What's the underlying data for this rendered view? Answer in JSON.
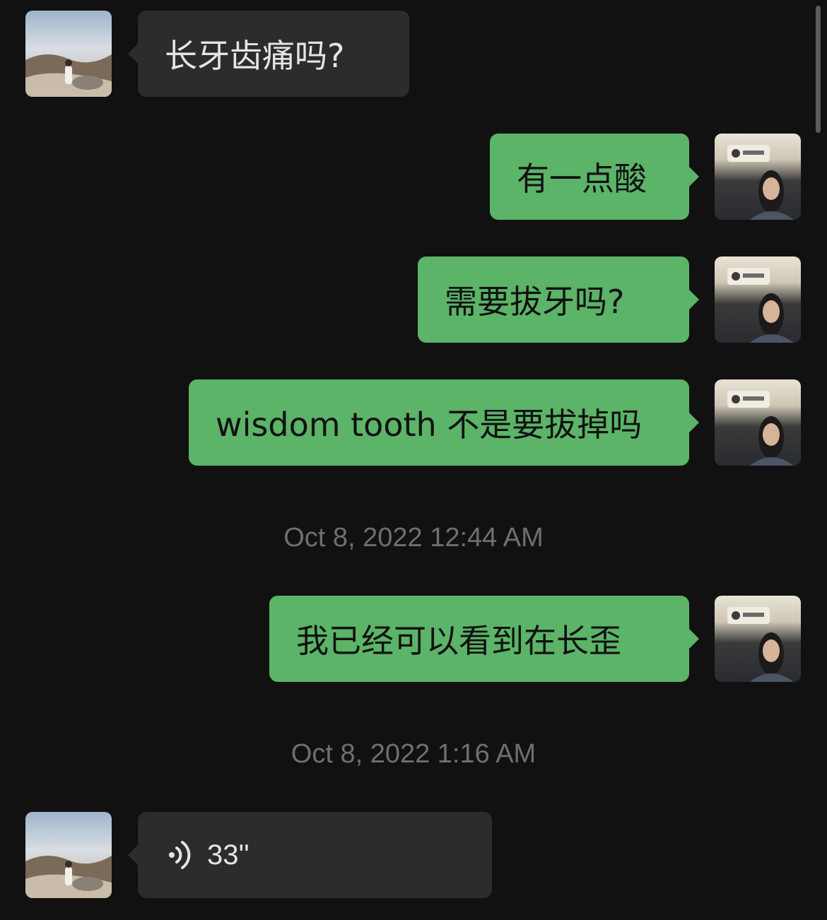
{
  "messages": [
    {
      "side": "in",
      "text": "长牙齿痛吗?"
    },
    {
      "side": "out",
      "text": "有一点酸"
    },
    {
      "side": "out",
      "text": "需要拔牙吗?"
    },
    {
      "side": "out",
      "text": "wisdom tooth 不是要拔掉吗"
    },
    {
      "side": "out",
      "text": "我已经可以看到在长歪"
    },
    {
      "side": "in",
      "type": "voice",
      "duration": "33''"
    }
  ],
  "timestamps": [
    "Oct 8, 2022 12:44 AM",
    "Oct 8, 2022 1:16 AM"
  ],
  "colors": {
    "background": "#111111",
    "incoming_bubble": "#2c2c2c",
    "outgoing_bubble": "#5bb468",
    "timestamp_text": "#6f6f6f"
  },
  "icons": {
    "voice": "voice-wave-icon",
    "contact_avatar": "contact-avatar",
    "self_avatar": "self-avatar"
  }
}
